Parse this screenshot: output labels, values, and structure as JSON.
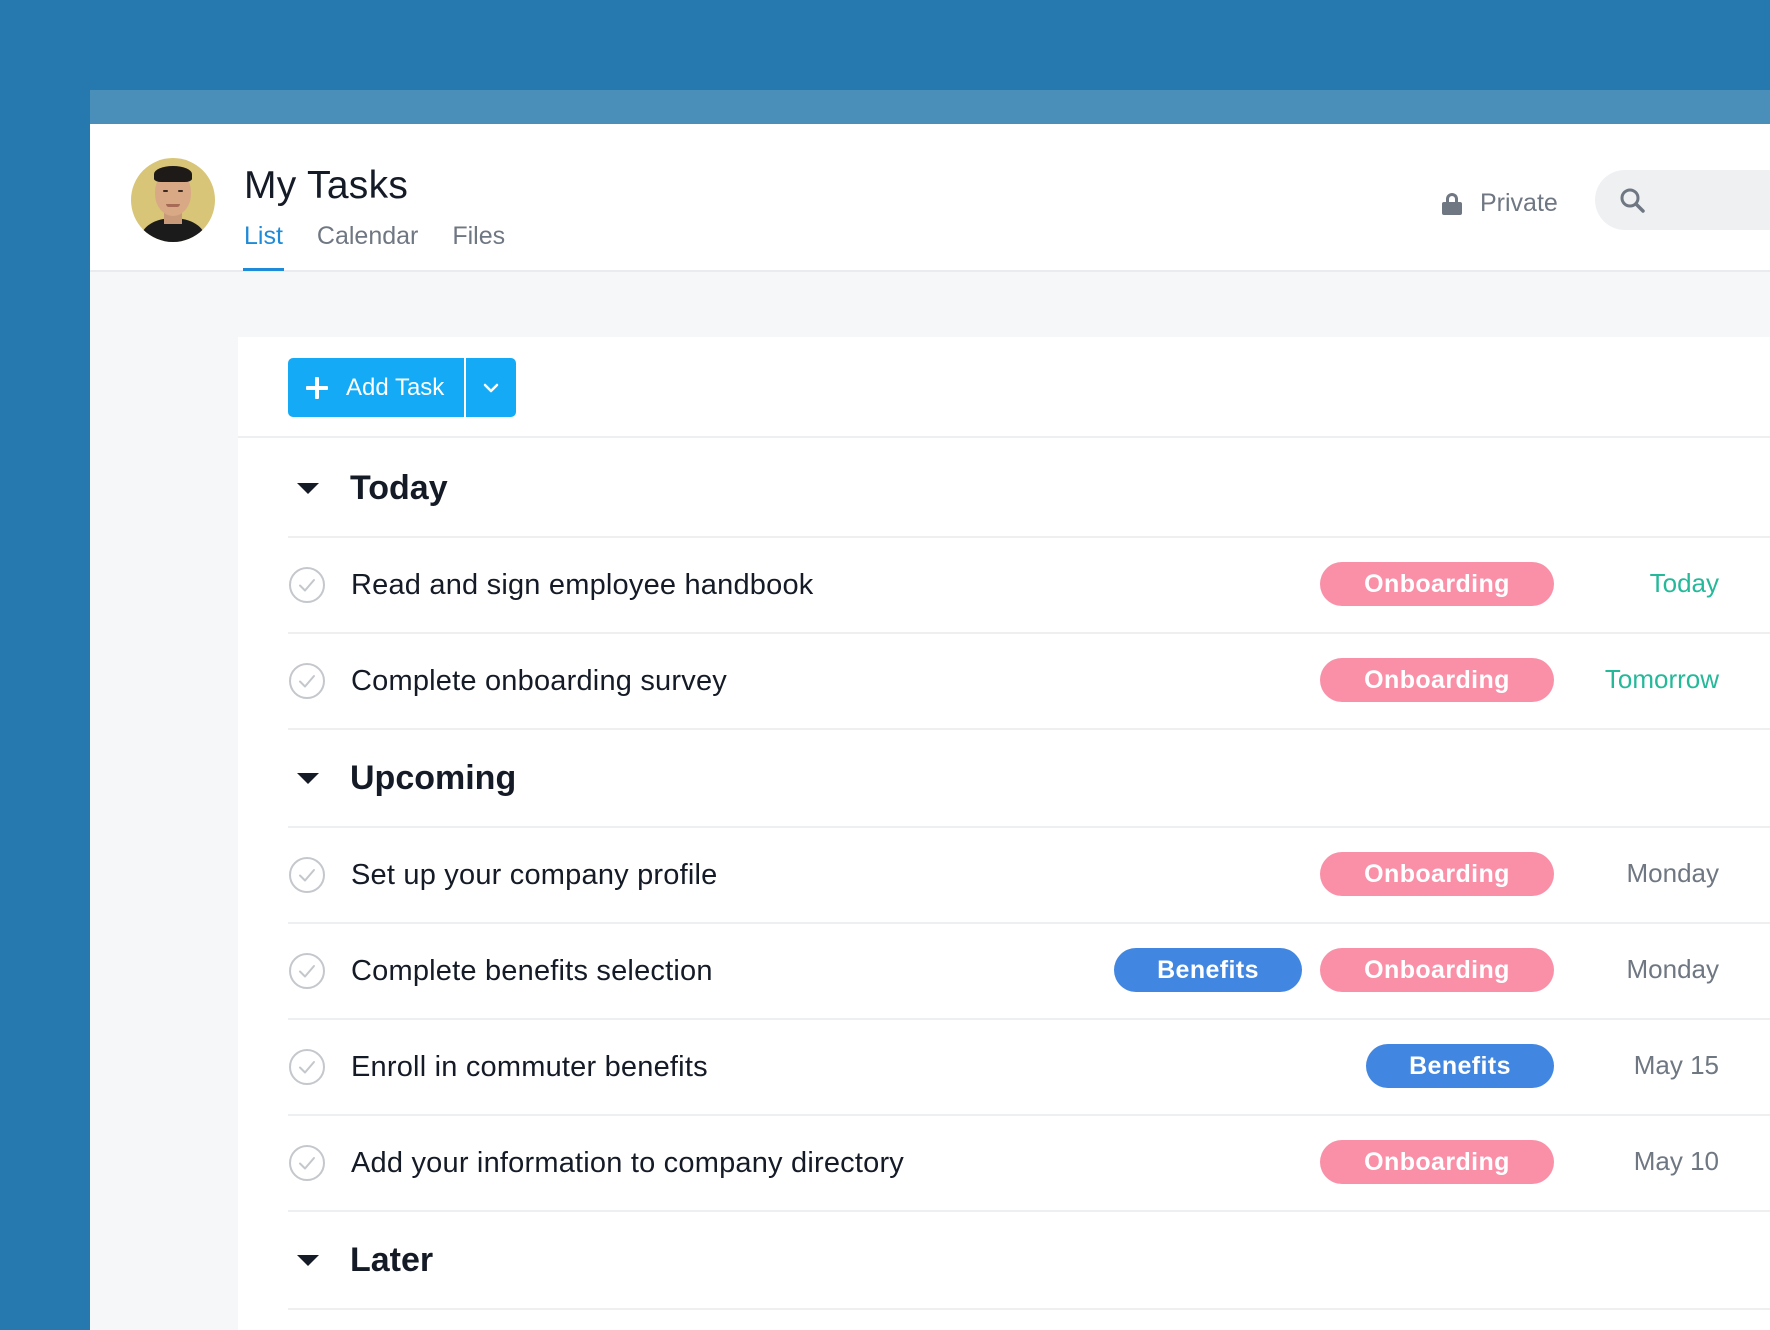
{
  "header": {
    "title": "My Tasks",
    "tabs": [
      {
        "label": "List",
        "active": true
      },
      {
        "label": "Calendar",
        "active": false
      },
      {
        "label": "Files",
        "active": false
      }
    ],
    "privacy_label": "Private"
  },
  "toolbar": {
    "add_task_label": "Add Task"
  },
  "colors": {
    "background": "#2579ae",
    "accent": "#14aaf5",
    "tab_active": "#1f8bd8",
    "tag_onboarding": "#f990a8",
    "tag_benefits": "#4186e0",
    "due_soon": "#25b99a"
  },
  "sections": [
    {
      "label": "Today",
      "tasks": [
        {
          "name": "Read and sign employee handbook",
          "tags": [
            "Onboarding"
          ],
          "due": "Today",
          "due_soon": true
        },
        {
          "name": "Complete onboarding survey",
          "tags": [
            "Onboarding"
          ],
          "due": "Tomorrow",
          "due_soon": true
        }
      ]
    },
    {
      "label": "Upcoming",
      "tasks": [
        {
          "name": "Set up your company profile",
          "tags": [
            "Onboarding"
          ],
          "due": "Monday",
          "due_soon": false
        },
        {
          "name": "Complete benefits selection",
          "tags": [
            "Benefits",
            "Onboarding"
          ],
          "due": "Monday",
          "due_soon": false
        },
        {
          "name": "Enroll in commuter benefits",
          "tags": [
            "Benefits"
          ],
          "due": "May 15",
          "due_soon": false
        },
        {
          "name": "Add your information to company directory",
          "tags": [
            "Onboarding"
          ],
          "due": "May 10",
          "due_soon": false
        }
      ]
    },
    {
      "label": "Later",
      "tasks": []
    }
  ]
}
